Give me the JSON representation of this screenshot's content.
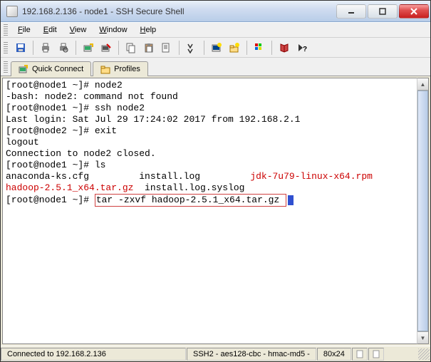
{
  "window": {
    "title": "192.168.2.136 - node1 - SSH Secure Shell"
  },
  "menu": {
    "file": "File",
    "edit": "Edit",
    "view": "View",
    "window": "Window",
    "help": "Help"
  },
  "tabs": {
    "quick_connect": "Quick Connect",
    "profiles": "Profiles"
  },
  "terminal": {
    "l1_prompt": "[root@node1 ~]# ",
    "l1_cmd": "node2",
    "l2": "-bash: node2: command not found",
    "l3_prompt": "[root@node1 ~]# ",
    "l3_cmd": "ssh node2",
    "l4": "Last login: Sat Jul 29 17:24:02 2017 from 192.168.2.1",
    "l5_prompt": "[root@node2 ~]# ",
    "l5_cmd": "exit",
    "l6": "logout",
    "l7": "Connection to node2 closed.",
    "l8_prompt": "[root@node1 ~]# ",
    "l8_cmd": "ls",
    "l9_a": "anaconda-ks.cfg",
    "l9_b": "install.log",
    "l9_c": "jdk-7u79-linux-x64.rpm",
    "l10_a": "hadoop-2.5.1_x64.tar.gz",
    "l10_b": "install.log.syslog",
    "l11_prompt": "[root@node1 ~]# ",
    "l11_cmd": "tar -zxvf hadoop-2.5.1_x64.tar.gz "
  },
  "status": {
    "connected": "Connected to 192.168.2.136",
    "proto": "SSH2 - aes128-cbc - hmac-md5 -",
    "size": "80x24"
  },
  "icons": {
    "save": "save-icon",
    "print": "print-icon",
    "print2": "print-preview-icon",
    "new": "new-connection-icon",
    "disconnect": "disconnect-icon",
    "copy": "copy-icon",
    "paste": "paste-icon",
    "edit": "edit-icon",
    "find": "find-icon",
    "terminal": "terminal-icon",
    "transfer": "transfer-icon",
    "color": "color-icon",
    "prefs": "prefs-icon",
    "help": "help-icon"
  }
}
